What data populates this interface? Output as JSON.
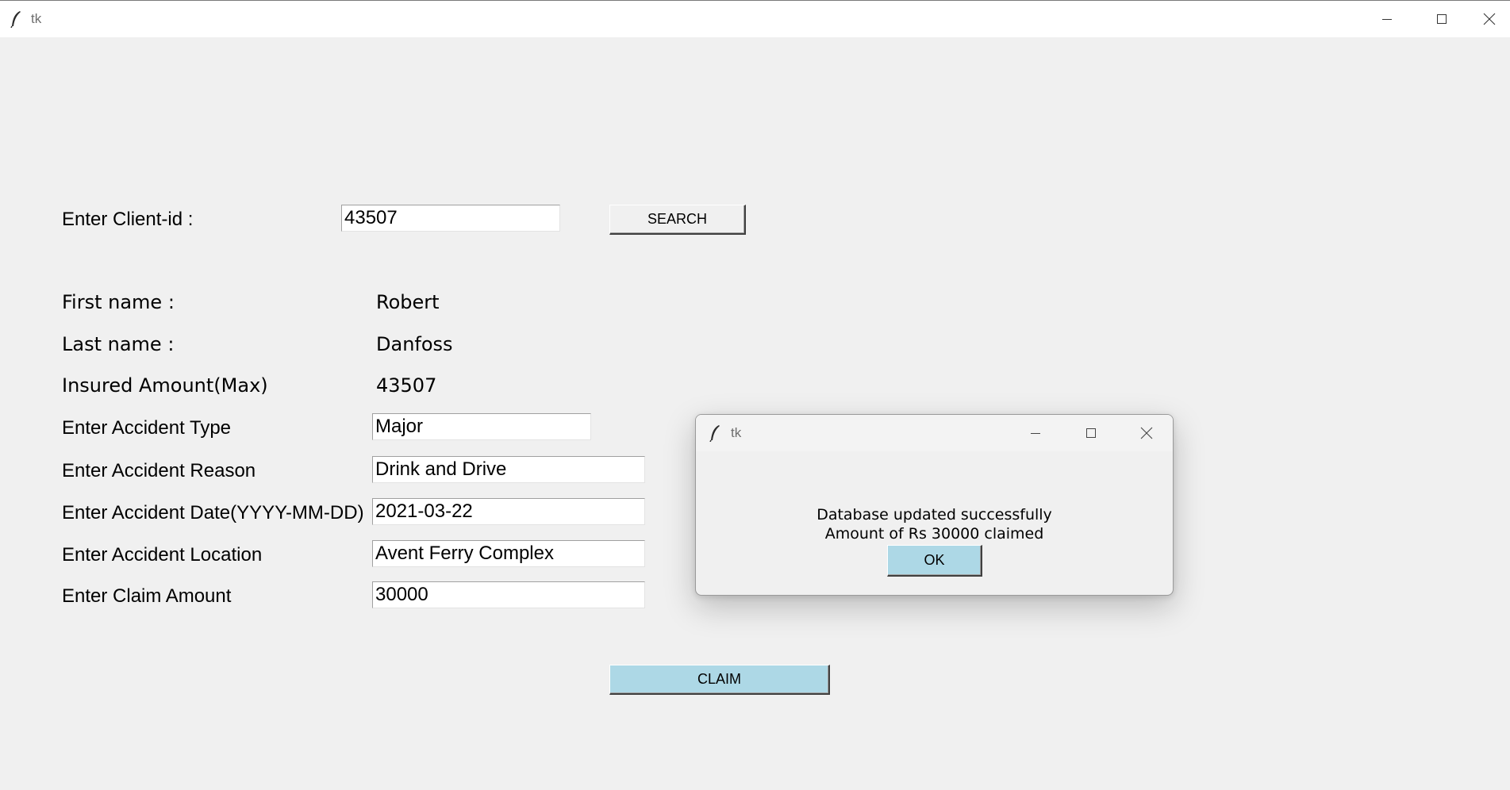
{
  "window": {
    "title": "tk"
  },
  "client_search": {
    "label": "Enter Client-id :",
    "value": "43507",
    "button": "SEARCH"
  },
  "info": {
    "first_name_label": "First name :",
    "first_name_value": "Robert",
    "last_name_label": "Last name :",
    "last_name_value": "Danfoss",
    "insured_label": "Insured Amount(Max)",
    "insured_value": "43507"
  },
  "form": {
    "accident_type_label": "Enter Accident Type",
    "accident_type_value": "Major",
    "accident_reason_label": "Enter Accident Reason",
    "accident_reason_value": "Drink and Drive",
    "accident_date_label": "Enter Accident Date(YYYY-MM-DD)",
    "accident_date_value": "2021-03-22",
    "accident_location_label": "Enter Accident Location",
    "accident_location_value": "Avent Ferry Complex",
    "claim_amount_label": "Enter Claim Amount",
    "claim_amount_value": "30000"
  },
  "claim_button": "CLAIM",
  "dialog": {
    "title": "tk",
    "message_line1": "Database updated successfully",
    "message_line2": "Amount of Rs 30000 claimed",
    "ok_button": "OK"
  },
  "colors": {
    "background": "#f0f0f0",
    "button_blue": "#add8e6",
    "entry_bg": "#ffffff"
  },
  "icons": [
    "feather-icon",
    "minimize-icon",
    "maximize-icon",
    "close-icon"
  ]
}
